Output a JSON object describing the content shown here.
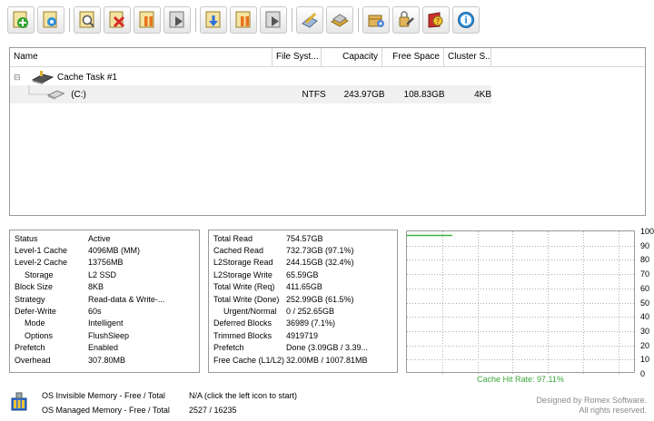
{
  "toolbar": {
    "buttons": [
      {
        "icon": "add-icon"
      },
      {
        "icon": "settings-icon"
      },
      {
        "icon": "properties-icon"
      },
      {
        "icon": "delete-icon"
      },
      {
        "icon": "pause-icon"
      },
      {
        "icon": "play-icon"
      },
      {
        "icon": "download-icon"
      },
      {
        "icon": "pause-all-icon"
      },
      {
        "icon": "play-all-icon"
      },
      {
        "icon": "edit-icon"
      },
      {
        "icon": "license-icon"
      },
      {
        "icon": "package-icon"
      },
      {
        "icon": "tools-icon"
      },
      {
        "icon": "help-icon"
      },
      {
        "icon": "about-icon"
      }
    ]
  },
  "tree": {
    "columns": [
      "Name",
      "File Syst...",
      "Capacity",
      "Free Space",
      "Cluster S..."
    ],
    "task": {
      "label": "Cache Task #1",
      "expander": "⊟"
    },
    "disk": {
      "name": "(C:)",
      "filesystem": "NTFS",
      "capacity": "243.97GB",
      "free_space": "108.83GB",
      "cluster": "4KB"
    }
  },
  "status_panel": [
    {
      "label": "Status",
      "value": "Active"
    },
    {
      "label": "Level-1 Cache",
      "value": "4096MB (MM)"
    },
    {
      "label": "Level-2 Cache",
      "value": "13756MB"
    },
    {
      "label": "Storage",
      "value": "L2 SSD"
    },
    {
      "label": "Block Size",
      "value": "8KB"
    },
    {
      "label": "Strategy",
      "value": "Read-data & Write-..."
    },
    {
      "label": "Defer-Write",
      "value": "60s"
    },
    {
      "label": "Mode",
      "value": "Intelligent"
    },
    {
      "label": "Options",
      "value": "FlushSleep"
    },
    {
      "label": "Prefetch",
      "value": "Enabled"
    },
    {
      "label": "Overhead",
      "value": "307.80MB"
    }
  ],
  "stats_panel": [
    {
      "label": "Total Read",
      "value": "754.57GB"
    },
    {
      "label": "Cached Read",
      "value": "732.73GB (97.1%)"
    },
    {
      "label": "L2Storage Read",
      "value": "244.15GB (32.4%)"
    },
    {
      "label": "L2Storage Write",
      "value": "65.59GB"
    },
    {
      "label": "Total Write (Req)",
      "value": "411.65GB"
    },
    {
      "label": "Total Write (Done)",
      "value": "252.99GB (61.5%)"
    },
    {
      "label": "Urgent/Normal",
      "value": "0 / 252.65GB"
    },
    {
      "label": "Deferred Blocks",
      "value": "36989 (7.1%)"
    },
    {
      "label": "Trimmed Blocks",
      "value": "4919719"
    },
    {
      "label": "Prefetch",
      "value": "Done (3.09GB / 3.39..."
    },
    {
      "label": "Free Cache (L1/L2)",
      "value": "32.00MB / 1007.81MB"
    }
  ],
  "graph": {
    "y_ticks": [
      "100",
      "90",
      "80",
      "70",
      "60",
      "50",
      "40",
      "30",
      "20",
      "10",
      "0"
    ],
    "caption": "Cache Hit Rate: 97.11%",
    "line_color": "#3cb43c",
    "hit_rate": 97.11
  },
  "footer": {
    "invisible_label": "OS Invisible Memory - Free / Total",
    "invisible_value": "N/A (click the left icon to start)",
    "managed_label": "OS Managed Memory - Free / Total",
    "managed_value": "2527 / 16235",
    "credit_line1": "Designed by Romex Software.",
    "credit_line2": "All rights reserved."
  }
}
